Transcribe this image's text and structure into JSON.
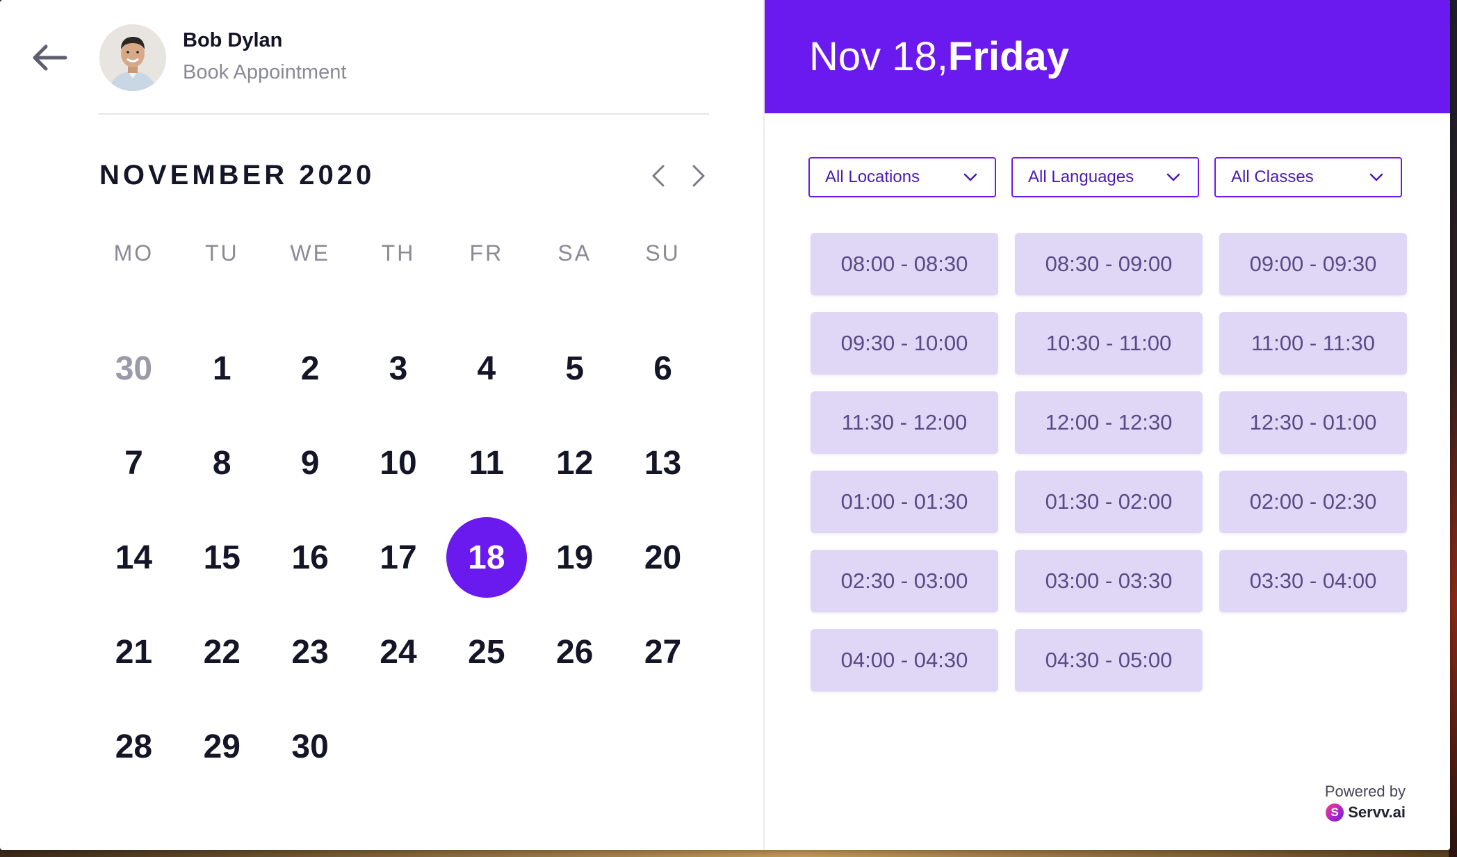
{
  "user": {
    "name": "Bob Dylan",
    "subtitle": "Book Appointment"
  },
  "calendar": {
    "month_label": "NOVEMBER 2020",
    "weekdays": [
      "MO",
      "TU",
      "WE",
      "TH",
      "FR",
      "SA",
      "SU"
    ],
    "weeks": [
      [
        {
          "d": "30",
          "muted": true
        },
        {
          "d": "1"
        },
        {
          "d": "2"
        },
        {
          "d": "3"
        },
        {
          "d": "4"
        },
        {
          "d": "5"
        },
        {
          "d": "6"
        }
      ],
      [
        {
          "d": "7"
        },
        {
          "d": "8"
        },
        {
          "d": "9"
        },
        {
          "d": "10"
        },
        {
          "d": "11"
        },
        {
          "d": "12"
        },
        {
          "d": "13"
        }
      ],
      [
        {
          "d": "14"
        },
        {
          "d": "15"
        },
        {
          "d": "16"
        },
        {
          "d": "17"
        },
        {
          "d": "18",
          "selected": true
        },
        {
          "d": "19"
        },
        {
          "d": "20"
        }
      ],
      [
        {
          "d": "21"
        },
        {
          "d": "22"
        },
        {
          "d": "23"
        },
        {
          "d": "24"
        },
        {
          "d": "25"
        },
        {
          "d": "26"
        },
        {
          "d": "27"
        }
      ],
      [
        {
          "d": "28"
        },
        {
          "d": "29"
        },
        {
          "d": "30"
        },
        null,
        null,
        null,
        null
      ]
    ],
    "selected_day": "18"
  },
  "header": {
    "date": "Nov 18, ",
    "weekday": "Friday"
  },
  "filters": [
    {
      "label": "All Locations",
      "name": "locations-select"
    },
    {
      "label": "All Languages",
      "name": "languages-select"
    },
    {
      "label": "All Classes",
      "name": "classes-select"
    }
  ],
  "time_slots": [
    "08:00 - 08:30",
    "08:30 - 09:00",
    "09:00 - 09:30",
    "09:30 - 10:00",
    "10:30 - 11:00",
    "11:00 - 11:30",
    "11:30 - 12:00",
    "12:00 - 12:30",
    "12:30 - 01:00",
    "01:00 - 01:30",
    "01:30 - 02:00",
    "02:00 - 02:30",
    "02:30 - 03:00",
    "03:00 - 03:30",
    "03:30 - 04:00",
    "04:00 - 04:30",
    "04:30 - 05:00"
  ],
  "footer": {
    "powered_by": "Powered by",
    "brand_letter": "S",
    "brand_name": "Servv.ai"
  },
  "colors": {
    "accent": "#6a19ee",
    "slot_bg": "#e0d7f6",
    "slot_text": "#5b4a86"
  },
  "icons": {
    "back": "arrow-left-icon",
    "prev": "chevron-left-icon",
    "next": "chevron-right-icon",
    "dropdown": "chevron-down-icon"
  }
}
